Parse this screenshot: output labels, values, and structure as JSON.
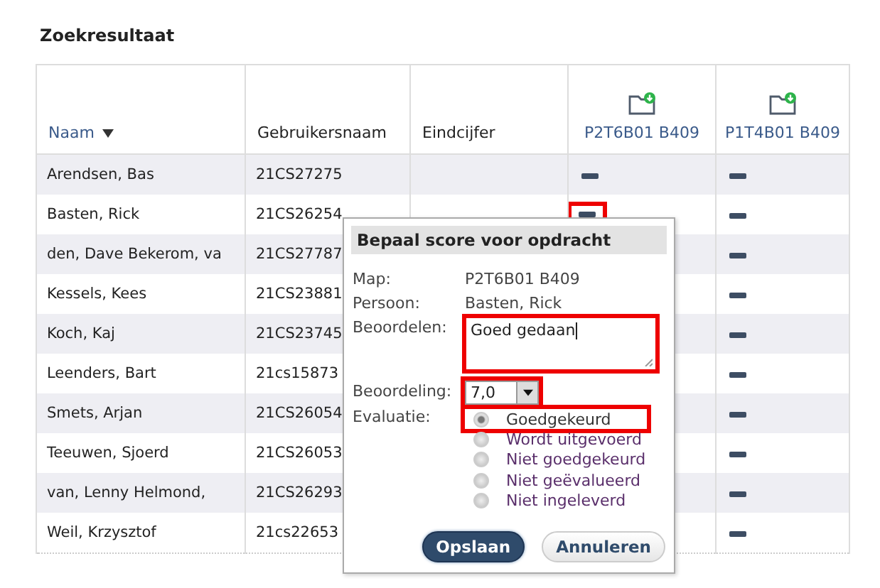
{
  "title": "Zoekresultaat",
  "table": {
    "columns": [
      {
        "label": "Naam",
        "kind": "sorted"
      },
      {
        "label": "Gebruikersnaam",
        "kind": "plain"
      },
      {
        "label": "Eindcijfer",
        "kind": "plain"
      },
      {
        "label": "P2T6B01 B409",
        "kind": "assignment"
      },
      {
        "label": "P1T4B01 B409",
        "kind": "assignment"
      }
    ],
    "rows": [
      {
        "name": "Arendsen, Bas",
        "user": "21CS27275",
        "p2t6b01": {
          "highlighted": false
        },
        "p1t4b01": {
          "highlighted": false
        }
      },
      {
        "name": "Basten, Rick",
        "user": "21CS26254",
        "p2t6b01": {
          "highlighted": true
        },
        "p1t4b01": {
          "highlighted": false
        }
      },
      {
        "name": "den, Dave Bekerom, va",
        "user": "21CS27787",
        "p1t4b01": {
          "highlighted": false
        }
      },
      {
        "name": "Kessels, Kees",
        "user": "21CS23881",
        "p1t4b01": {
          "highlighted": false
        }
      },
      {
        "name": "Koch, Kaj",
        "user": "21CS23745",
        "p1t4b01": {
          "highlighted": false
        }
      },
      {
        "name": "Leenders, Bart",
        "user": "21cs15873",
        "p1t4b01": {
          "highlighted": false
        }
      },
      {
        "name": "Smets, Arjan",
        "user": "21CS26054",
        "p1t4b01": {
          "highlighted": false
        }
      },
      {
        "name": "Teeuwen, Sjoerd",
        "user": "21CS26053",
        "p1t4b01": {
          "highlighted": false
        }
      },
      {
        "name": "van, Lenny Helmond,",
        "user": "21CS26293",
        "p1t4b01": {
          "highlighted": false
        }
      },
      {
        "name": "Weil, Krzysztof",
        "user": "21cs22653",
        "p1t4b01": {
          "highlighted": false
        }
      }
    ]
  },
  "dialog": {
    "title": "Bepaal score voor opdracht",
    "map_label": "Map:",
    "map_value": "P2T6B01 B409",
    "person_label": "Persoon:",
    "person_value": "Basten, Rick",
    "comment_label": "Beoordelen:",
    "comment_value": "Goed gedaan",
    "comment_highlighted": true,
    "grade_label": "Beoordeling:",
    "grade_value": "7,0",
    "grade_highlighted": true,
    "evaluation_label": "Evaluatie:",
    "options": [
      {
        "label": "Goedgekeurd",
        "selected": true,
        "highlighted": true
      },
      {
        "label": "Wordt uitgevoerd",
        "selected": false,
        "highlighted": false
      },
      {
        "label": "Niet goedgekeurd",
        "selected": false,
        "highlighted": false
      },
      {
        "label": "Niet geëvalueerd",
        "selected": false,
        "highlighted": false
      },
      {
        "label": "Niet ingeleverd",
        "selected": false,
        "highlighted": false
      }
    ],
    "buttons": [
      {
        "label": "Opslaan",
        "kind": "primary"
      },
      {
        "label": "Annuleren",
        "kind": "secondary"
      }
    ]
  }
}
